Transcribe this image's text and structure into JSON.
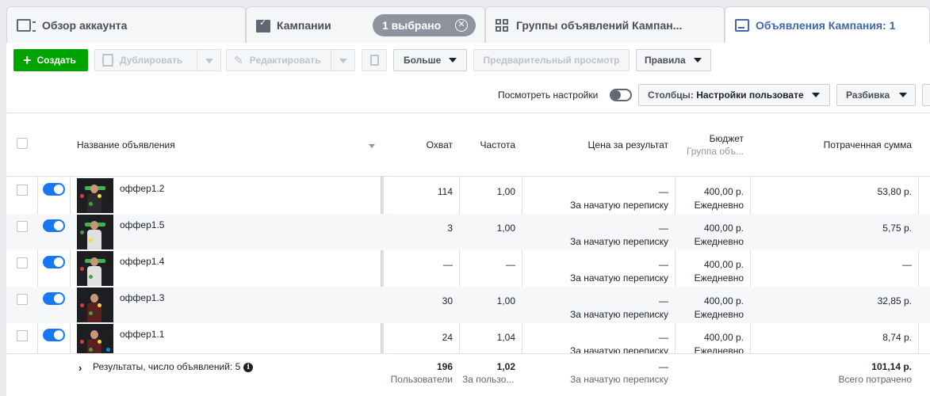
{
  "tabs": [
    {
      "label": "Обзор аккаунта",
      "icon": "account-overview-icon"
    },
    {
      "label": "Кампании",
      "icon": "campaign-folder-icon"
    },
    {
      "label": "Группы объявлений Кампан...",
      "icon": "ad-sets-grid-icon"
    },
    {
      "label": "Объявления Кампания: 1",
      "icon": "ad-icon"
    }
  ],
  "selection": {
    "label": "1 выбрано"
  },
  "toolbar": {
    "create": "Создать",
    "duplicate": "Дублировать",
    "edit": "Редактировать",
    "more": "Больше",
    "preview": "Предварительный просмотр",
    "rules": "Правила"
  },
  "toolbar2": {
    "view_settings": "Посмотреть настройки",
    "columns_prefix": "Столбцы: ",
    "columns_value": "Настройки пользовате",
    "breakdown": "Разбивка"
  },
  "columns": {
    "name": "Название объявления",
    "reach": "Охват",
    "frequency": "Частота",
    "cpr": "Цена за результат",
    "budget": "Бюджет",
    "budget_sub": "Группа объ...",
    "spent": "Потраченная сумма"
  },
  "rows": [
    {
      "name": "оффер1.2",
      "reach": "114",
      "frequency": "1,00",
      "cpr": "—",
      "cpr_sub": "За начатую переписку",
      "budget": "400,00 р.",
      "budget_sub": "Ежедневно",
      "spent": "53,80 р."
    },
    {
      "name": "оффер1.5",
      "reach": "3",
      "frequency": "1,00",
      "cpr": "—",
      "cpr_sub": "За начатую переписку",
      "budget": "400,00 р.",
      "budget_sub": "Ежедневно",
      "spent": "5,75 р."
    },
    {
      "name": "оффер1.4",
      "reach": "—",
      "frequency": "—",
      "cpr": "—",
      "cpr_sub": "За начатую переписку",
      "budget": "400,00 р.",
      "budget_sub": "Ежедневно",
      "spent": "—"
    },
    {
      "name": "оффер1.3",
      "reach": "30",
      "frequency": "1,00",
      "cpr": "—",
      "cpr_sub": "За начатую переписку",
      "budget": "400,00 р.",
      "budget_sub": "Ежедневно",
      "spent": "32,85 р."
    },
    {
      "name": "оффер1.1",
      "reach": "24",
      "frequency": "1,04",
      "cpr": "—",
      "cpr_sub": "За начатую переписку",
      "budget": "400,00 р.",
      "budget_sub": "Ежедневно",
      "spent": "8,74 р."
    }
  ],
  "totals": {
    "label": "Результаты, число объявлений: 5",
    "reach": "196",
    "reach_sub": "Пользователи",
    "frequency": "1,02",
    "frequency_sub": "За пользо...",
    "cpr": "—",
    "cpr_sub": "За начатую переписку",
    "spent": "101,14 р.",
    "spent_sub": "Всего потрачено"
  },
  "colors": {
    "accent": "#4267b2",
    "create": "#00a400",
    "toggle_on": "#1877f2"
  }
}
